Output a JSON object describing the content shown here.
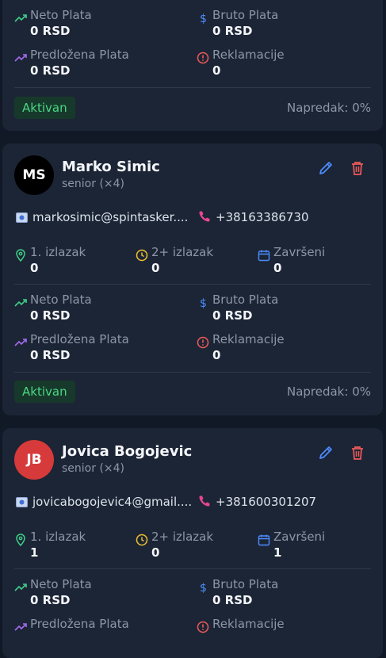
{
  "cards": [
    {
      "neto_label": "Neto Plata",
      "neto_value": "0 RSD",
      "bruto_label": "Bruto Plata",
      "bruto_value": "0 RSD",
      "predlozena_label": "Predložena Plata",
      "predlozena_value": "0 RSD",
      "reklamacije_label": "Reklamacije",
      "reklamacije_value": "0",
      "status": "Aktivan",
      "progress": "Napredak: 0%"
    },
    {
      "initials": "MS",
      "name": "Marko Simic",
      "role": "senior (×4)",
      "email": "markosimic@spintasker....",
      "phone": "+38163386730",
      "izlazak1_label": "1. izlazak",
      "izlazak1_value": "0",
      "izlazak2_label": "2+ izlazak",
      "izlazak2_value": "0",
      "zavrseni_label": "Završeni",
      "zavrseni_value": "0",
      "neto_label": "Neto Plata",
      "neto_value": "0 RSD",
      "bruto_label": "Bruto Plata",
      "bruto_value": "0 RSD",
      "predlozena_label": "Predložena Plata",
      "predlozena_value": "0 RSD",
      "reklamacije_label": "Reklamacije",
      "reklamacije_value": "0",
      "status": "Aktivan",
      "progress": "Napredak: 0%",
      "avatar_color": "#000000"
    },
    {
      "initials": "JB",
      "name": "Jovica Bogojevic",
      "role": "senior (×4)",
      "email": "jovicabogojevic4@gmail....",
      "phone": "+381600301207",
      "izlazak1_label": "1. izlazak",
      "izlazak1_value": "1",
      "izlazak2_label": "2+ izlazak",
      "izlazak2_value": "0",
      "zavrseni_label": "Završeni",
      "zavrseni_value": "1",
      "neto_label": "Neto Plata",
      "neto_value": "0 RSD",
      "bruto_label": "Bruto Plata",
      "bruto_value": "0 RSD",
      "predlozena_label": "Predložena Plata",
      "predlozena_value": "",
      "reklamacije_label": "Reklamacije",
      "reklamacije_value": "",
      "avatar_color": "#d63a3a"
    }
  ],
  "colors": {
    "background": "#111826",
    "card": "#1c2535",
    "accent_green": "#4ad683",
    "edit_blue": "#4c8dff",
    "delete_red": "#ef5a5a"
  },
  "icons": [
    "trending-up-icon",
    "dollar-icon",
    "alert-circle-icon",
    "map-pin-icon",
    "clock-icon",
    "calendar-icon",
    "email-icon",
    "phone-icon",
    "pencil-icon",
    "trash-icon"
  ]
}
